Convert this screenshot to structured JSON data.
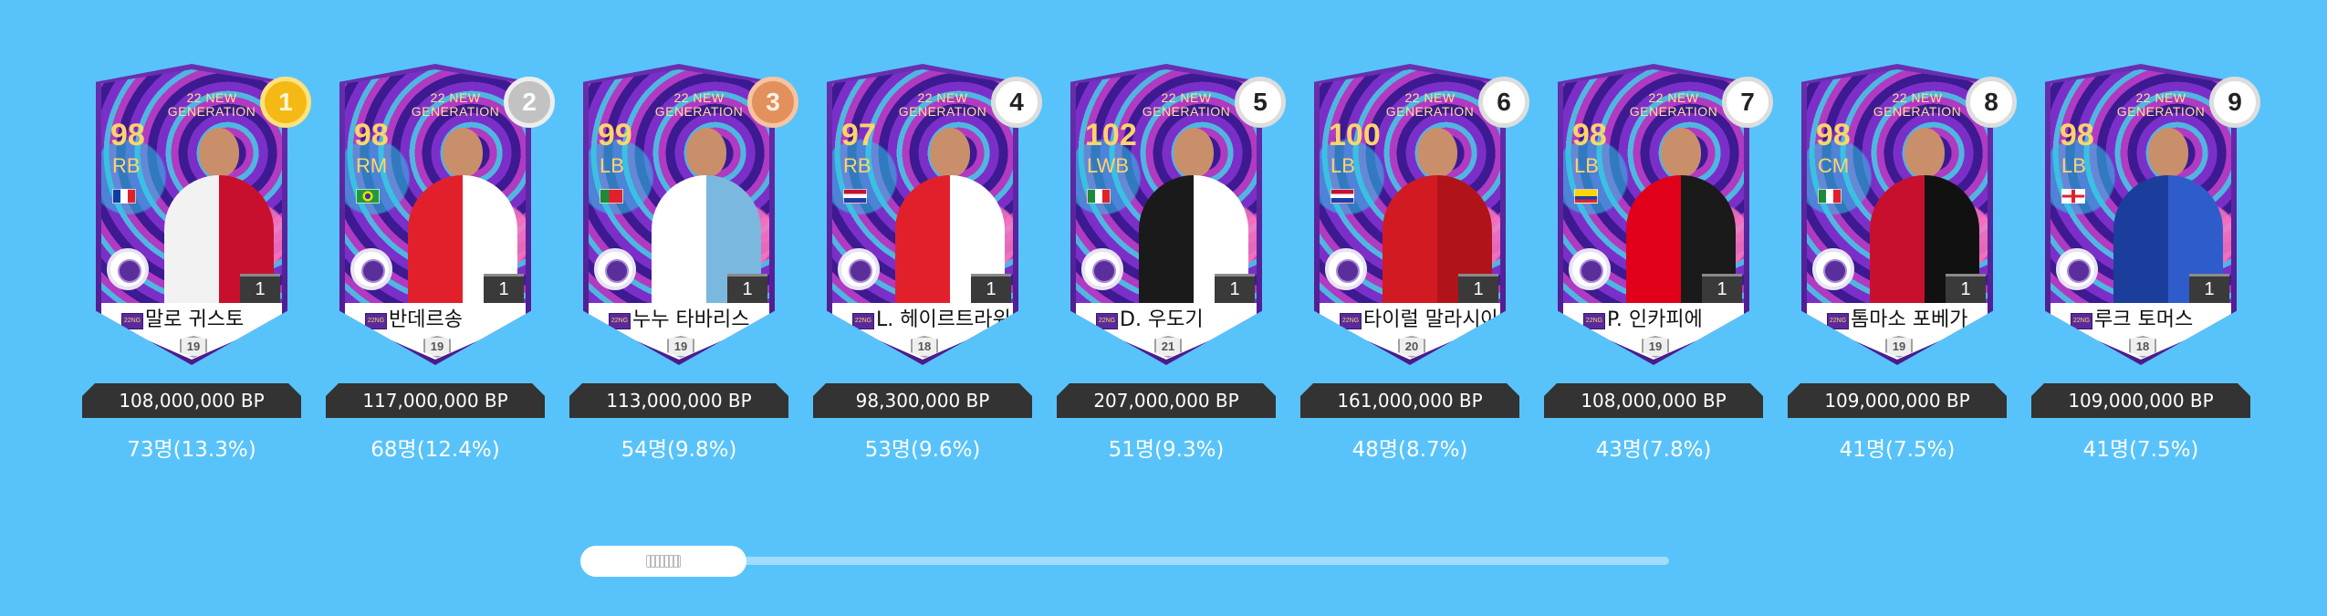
{
  "cards": [
    {
      "rank": "1",
      "medal": "gold",
      "season": "22 NEW\nGENERATION",
      "ovr": "98",
      "position": "RB",
      "flag": "france",
      "grade": "1",
      "season_icon": "22NG",
      "name": "말로 귀스토",
      "age": "19",
      "price": "108,000,000 BP",
      "pick_rate": "73명(13.3%)",
      "kit_colors": [
        "#f2f2f2",
        "#c8102e"
      ]
    },
    {
      "rank": "2",
      "medal": "silver",
      "season": "22 NEW\nGENERATION",
      "ovr": "98",
      "position": "RM",
      "flag": "brazil",
      "grade": "1",
      "season_icon": "22NG",
      "name": "반데르송",
      "age": "19",
      "price": "117,000,000 BP",
      "pick_rate": "68명(12.4%)",
      "kit_colors": [
        "#e2202c",
        "#ffffff"
      ]
    },
    {
      "rank": "3",
      "medal": "bronze",
      "season": "22 NEW\nGENERATION",
      "ovr": "99",
      "position": "LB",
      "flag": "portugal",
      "grade": "1",
      "season_icon": "22NG",
      "name": "누누 타바리스",
      "age": "19",
      "price": "113,000,000 BP",
      "pick_rate": "54명(9.8%)",
      "kit_colors": [
        "#ffffff",
        "#7ab8e0"
      ]
    },
    {
      "rank": "4",
      "medal": "plain",
      "season": "22 NEW\nGENERATION",
      "ovr": "97",
      "position": "RB",
      "flag": "netherlands",
      "grade": "1",
      "season_icon": "22NG",
      "name": "L. 헤이르트라위",
      "age": "18",
      "price": "98,300,000 BP",
      "pick_rate": "53명(9.6%)",
      "kit_colors": [
        "#e2202c",
        "#ffffff"
      ]
    },
    {
      "rank": "5",
      "medal": "plain",
      "season": "22 NEW\nGENERATION",
      "ovr": "102",
      "position": "LWB",
      "flag": "italy",
      "grade": "1",
      "season_icon": "22NG",
      "name": "D. 우도기",
      "age": "21",
      "price": "207,000,000 BP",
      "pick_rate": "51명(9.3%)",
      "kit_colors": [
        "#1a1a1a",
        "#ffffff"
      ]
    },
    {
      "rank": "6",
      "medal": "plain",
      "season": "22 NEW\nGENERATION",
      "ovr": "100",
      "position": "LB",
      "flag": "netherlands",
      "grade": "1",
      "season_icon": "22NG",
      "name": "타이럴 말라시아",
      "age": "20",
      "price": "161,000,000 BP",
      "pick_rate": "48명(8.7%)",
      "kit_colors": [
        "#d11a22",
        "#b0141a"
      ]
    },
    {
      "rank": "7",
      "medal": "plain",
      "season": "22 NEW\nGENERATION",
      "ovr": "98",
      "position": "LB",
      "flag": "ecuador",
      "grade": "1",
      "season_icon": "22NG",
      "name": "P. 인카피에",
      "age": "19",
      "price": "108,000,000 BP",
      "pick_rate": "43명(7.8%)",
      "kit_colors": [
        "#e1001a",
        "#1a1a1a"
      ]
    },
    {
      "rank": "8",
      "medal": "plain",
      "season": "22 NEW\nGENERATION",
      "ovr": "98",
      "position": "CM",
      "flag": "italy",
      "grade": "1",
      "season_icon": "22NG",
      "name": "톰마소 포베가",
      "age": "19",
      "price": "109,000,000 BP",
      "pick_rate": "41명(7.5%)",
      "kit_colors": [
        "#c8102e",
        "#111111"
      ]
    },
    {
      "rank": "9",
      "medal": "plain",
      "season": "22 NEW\nGENERATION",
      "ovr": "98",
      "position": "LB",
      "flag": "england",
      "grade": "1",
      "season_icon": "22NG",
      "name": "루크 토머스",
      "age": "18",
      "price": "109,000,000 BP",
      "pick_rate": "41명(7.5%)",
      "kit_colors": [
        "#1b3d9c",
        "#2f5ccb"
      ]
    }
  ],
  "scroll": {
    "position": 0
  }
}
